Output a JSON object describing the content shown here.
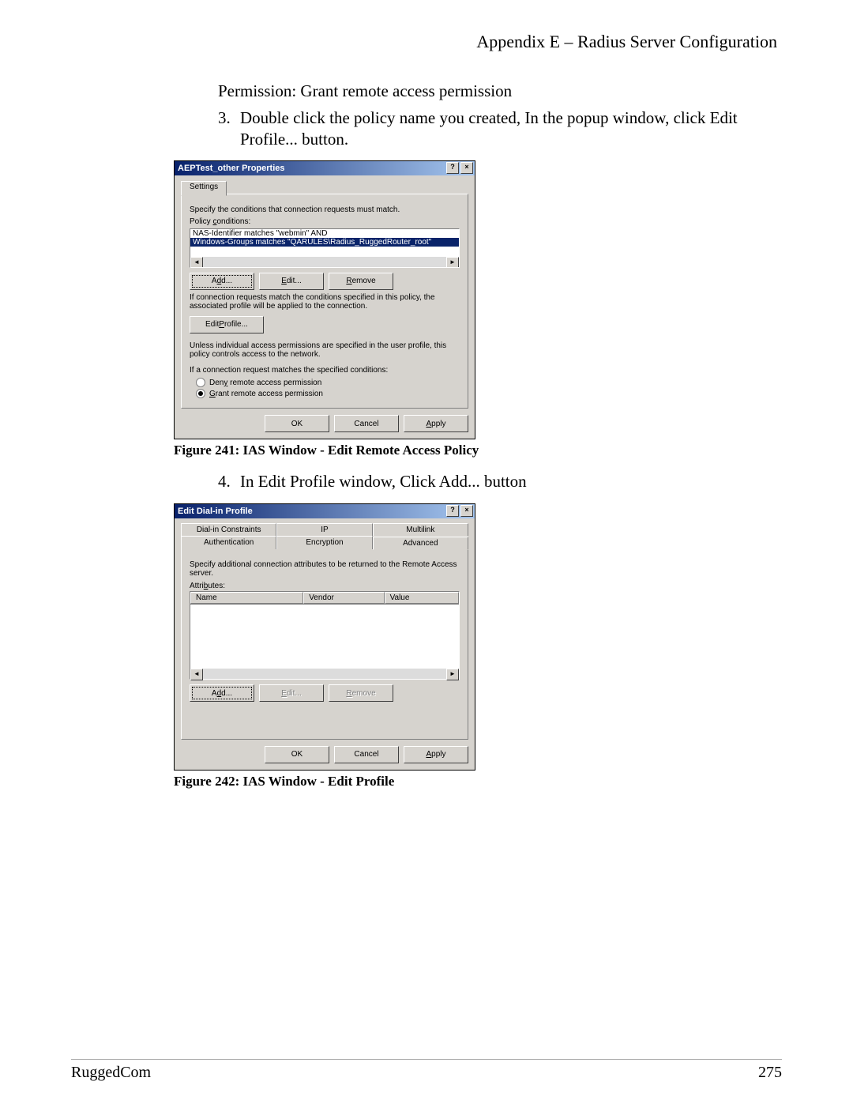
{
  "header": {
    "text": "Appendix E – Radius Server Configuration"
  },
  "body": {
    "perm_line": "Permission: Grant remote access permission",
    "step3_num": "3.",
    "step3_text": "Double click the policy name you created, In the popup window, click Edit Profile... button.",
    "step4_num": "4.",
    "step4_text": "In Edit Profile window, Click Add... button"
  },
  "fig241": {
    "caption": "Figure 241: IAS Window - Edit Remote Access Policy",
    "title": "AEPTest_other Properties",
    "tab": "Settings",
    "spec_text": "Specify the conditions that connection requests must match.",
    "conditions_label": "Policy conditions:",
    "cond1": "NAS-Identifier matches \"webmin\"  AND",
    "cond2": "Windows-Groups matches \"QARULES\\Radius_RuggedRouter_root\"",
    "add": "Add...",
    "edit": "Edit...",
    "remove": "Remove",
    "match_text": "If connection requests match the conditions specified in this policy, the associated profile will be applied to the connection.",
    "edit_profile": "Edit Profile...",
    "unless_text": "Unless individual access permissions are specified in the user profile, this policy controls access to the network.",
    "if_text": "If a connection request matches the specified conditions:",
    "deny": "Deny remote access permission",
    "grant": "Grant remote access permission",
    "ok": "OK",
    "cancel": "Cancel",
    "apply": "Apply"
  },
  "fig242": {
    "caption": "Figure 242: IAS Window - Edit Profile",
    "title": "Edit Dial-in Profile",
    "tabs": [
      "Dial-in Constraints",
      "IP",
      "Multilink",
      "Authentication",
      "Encryption",
      "Advanced"
    ],
    "spec_text": "Specify additional connection attributes to be returned to the Remote Access server.",
    "attrs_label": "Attributes:",
    "cols": {
      "name": "Name",
      "vendor": "Vendor",
      "value": "Value"
    },
    "add": "Add...",
    "edit": "Edit...",
    "remove": "Remove",
    "ok": "OK",
    "cancel": "Cancel",
    "apply": "Apply"
  },
  "footer": {
    "left": "RuggedCom",
    "right": "275"
  }
}
